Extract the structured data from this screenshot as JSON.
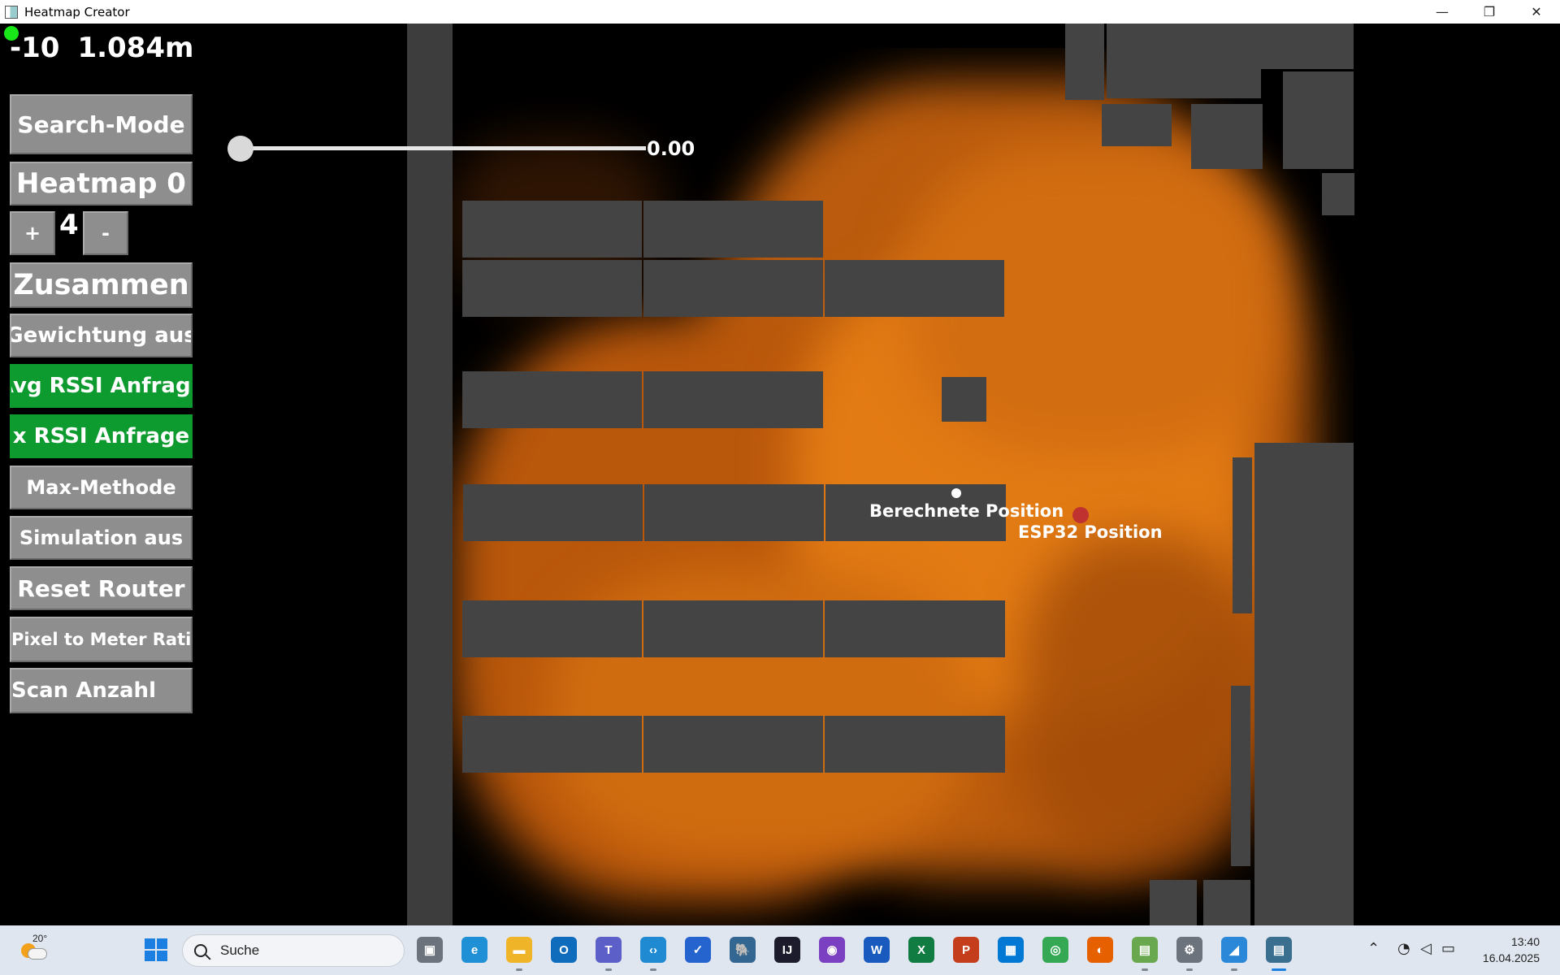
{
  "window": {
    "title": "Heatmap Creator",
    "minimize_glyph": "—",
    "restore_glyph": "❐",
    "close_glyph": "✕"
  },
  "hud": {
    "value": "-10",
    "distance": "1.084m",
    "status_color": "#18e818"
  },
  "controls": {
    "search_mode": "Search-Mode",
    "heatmap": "Heatmap 0",
    "plus": "+",
    "count": "4",
    "minus": "-",
    "zusammen": "Zusammen",
    "gewichtung": "Gewichtung aus",
    "avg_rssi": "Avg RSSI Anfrage",
    "x_rssi": "x RSSI Anfrage",
    "max_methode": "Max-Methode",
    "simulation": "Simulation aus",
    "reset_router": "Reset Router",
    "pixel_ratio": "Pixel to Meter Ratio",
    "scan_anzahl": "Scan Anzahl"
  },
  "slider": {
    "value_label": "0.00",
    "value": 0.0
  },
  "map": {
    "computed_label": "Berechnete Position",
    "esp_label": "ESP32 Position",
    "heat_color": "#e57a14"
  },
  "taskbar": {
    "weather_temp": "20°",
    "search_placeholder": "Suche",
    "time": "13:40",
    "date": "16.04.2025",
    "apps": [
      {
        "name": "task-view-icon",
        "color": "#6c737c",
        "glyph": "▣"
      },
      {
        "name": "edge-icon",
        "color": "#1f8fd6",
        "glyph": "e"
      },
      {
        "name": "file-explorer-icon",
        "color": "#f0b429",
        "glyph": "▬"
      },
      {
        "name": "outlook-icon",
        "color": "#0f6cbd",
        "glyph": "O"
      },
      {
        "name": "teams-icon",
        "color": "#5b5fc7",
        "glyph": "T"
      },
      {
        "name": "vscode-icon",
        "color": "#1f8ad2",
        "glyph": "‹›"
      },
      {
        "name": "todo-icon",
        "color": "#2564cf",
        "glyph": "✓"
      },
      {
        "name": "pgadmin-icon",
        "color": "#336791",
        "glyph": "🐘"
      },
      {
        "name": "intellij-icon",
        "color": "#1c1c2c",
        "glyph": "IJ"
      },
      {
        "name": "github-desktop-icon",
        "color": "#7b3fc1",
        "glyph": "◉"
      },
      {
        "name": "word-icon",
        "color": "#185abd",
        "glyph": "W"
      },
      {
        "name": "excel-icon",
        "color": "#107c41",
        "glyph": "X"
      },
      {
        "name": "powerpoint-icon",
        "color": "#c43e1c",
        "glyph": "P"
      },
      {
        "name": "company-portal-icon",
        "color": "#0078d4",
        "glyph": "▦"
      },
      {
        "name": "chrome-icon",
        "color": "#34a853",
        "glyph": "◎"
      },
      {
        "name": "firefox-icon",
        "color": "#e66000",
        "glyph": "◐"
      },
      {
        "name": "map-app-icon",
        "color": "#6aa84f",
        "glyph": "▤"
      },
      {
        "name": "settings-icon",
        "color": "#6c737c",
        "glyph": "⚙"
      },
      {
        "name": "photo-editor-icon",
        "color": "#2b88d8",
        "glyph": "◢"
      },
      {
        "name": "heatmap-creator-icon",
        "color": "#3a6f8f",
        "glyph": "▤"
      }
    ]
  }
}
